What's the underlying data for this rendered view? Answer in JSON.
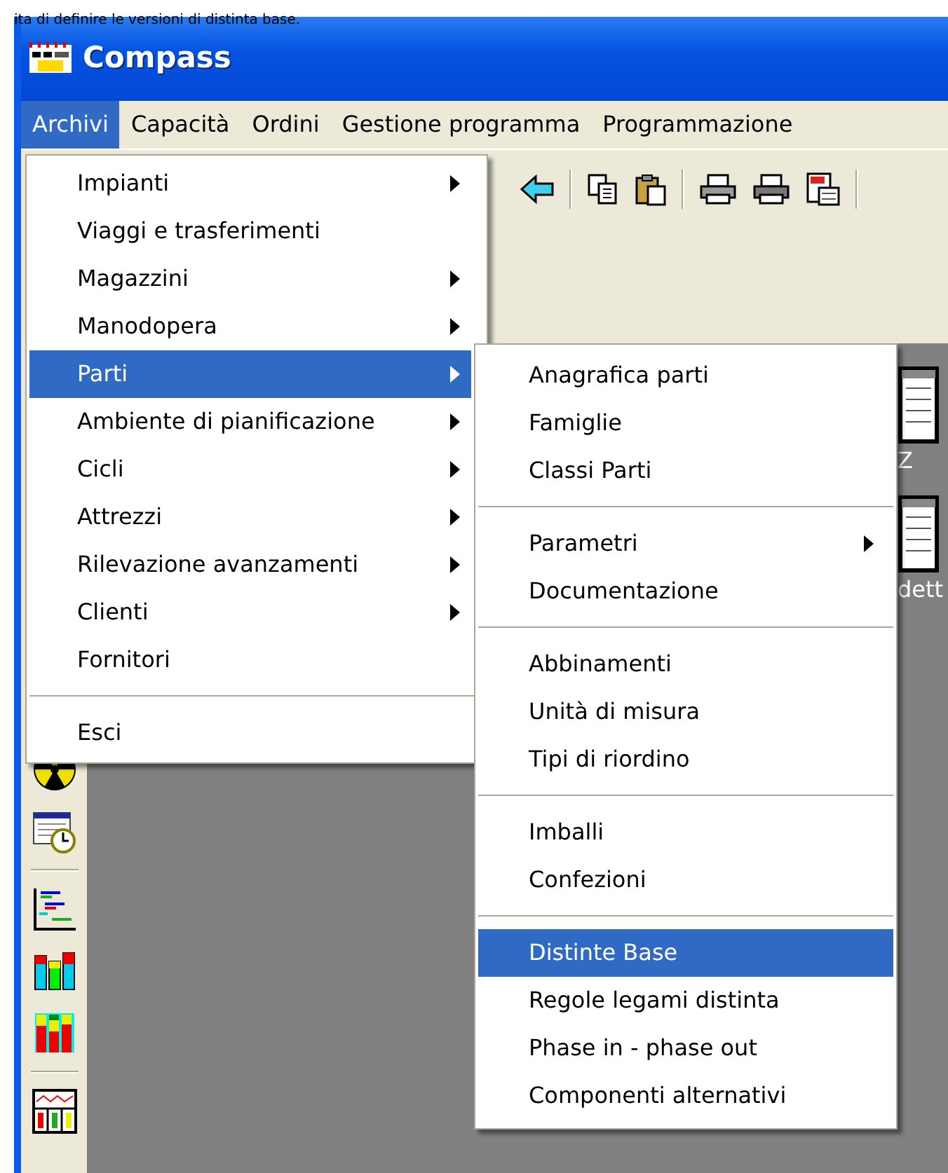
{
  "caption_text": "ita di definire le versioni di distinta base.",
  "window": {
    "title": "Compass"
  },
  "menubar": [
    {
      "label": "Archivi",
      "selected": true
    },
    {
      "label": "Capacità",
      "selected": false
    },
    {
      "label": "Ordini",
      "selected": false
    },
    {
      "label": "Gestione programma",
      "selected": false
    },
    {
      "label": "Programmazione",
      "selected": false
    }
  ],
  "menu": {
    "items": [
      {
        "kind": "item",
        "label": "Impianti",
        "submenu": true,
        "selected": false
      },
      {
        "kind": "item",
        "label": "Viaggi e trasferimenti",
        "submenu": false,
        "selected": false
      },
      {
        "kind": "item",
        "label": "Magazzini",
        "submenu": true,
        "selected": false
      },
      {
        "kind": "item",
        "label": "Manodopera",
        "submenu": true,
        "selected": false
      },
      {
        "kind": "item",
        "label": "Parti",
        "submenu": true,
        "selected": true
      },
      {
        "kind": "item",
        "label": "Ambiente di pianificazione",
        "submenu": true,
        "selected": false
      },
      {
        "kind": "item",
        "label": "Cicli",
        "submenu": true,
        "selected": false
      },
      {
        "kind": "item",
        "label": "Attrezzi",
        "submenu": true,
        "selected": false
      },
      {
        "kind": "item",
        "label": "Rilevazione avanzamenti",
        "submenu": true,
        "selected": false
      },
      {
        "kind": "item",
        "label": "Clienti",
        "submenu": true,
        "selected": false
      },
      {
        "kind": "item",
        "label": "Fornitori",
        "submenu": false,
        "selected": false
      },
      {
        "kind": "separator"
      },
      {
        "kind": "item",
        "label": "Esci",
        "submenu": false,
        "selected": false
      }
    ]
  },
  "submenu": {
    "items": [
      {
        "kind": "item",
        "label": "Anagrafica parti",
        "submenu": false,
        "selected": false
      },
      {
        "kind": "item",
        "label": "Famiglie",
        "submenu": false,
        "selected": false
      },
      {
        "kind": "item",
        "label": "Classi Parti",
        "submenu": false,
        "selected": false
      },
      {
        "kind": "separator"
      },
      {
        "kind": "item",
        "label": "Parametri",
        "submenu": true,
        "selected": false
      },
      {
        "kind": "item",
        "label": "Documentazione",
        "submenu": false,
        "selected": false
      },
      {
        "kind": "separator"
      },
      {
        "kind": "item",
        "label": "Abbinamenti",
        "submenu": false,
        "selected": false
      },
      {
        "kind": "item",
        "label": "Unità di misura",
        "submenu": false,
        "selected": false
      },
      {
        "kind": "item",
        "label": "Tipi di riordino",
        "submenu": false,
        "selected": false
      },
      {
        "kind": "separator"
      },
      {
        "kind": "item",
        "label": "Imballi",
        "submenu": false,
        "selected": false
      },
      {
        "kind": "item",
        "label": "Confezioni",
        "submenu": false,
        "selected": false
      },
      {
        "kind": "separator"
      },
      {
        "kind": "item",
        "label": "Distinte Base",
        "submenu": false,
        "selected": true
      },
      {
        "kind": "item",
        "label": "Regole legami distinta",
        "submenu": false,
        "selected": false
      },
      {
        "kind": "item",
        "label": "Phase in - phase out",
        "submenu": false,
        "selected": false
      },
      {
        "kind": "item",
        "label": "Componenti alternativi",
        "submenu": false,
        "selected": false
      }
    ]
  },
  "desktop_icons": [
    {
      "label": "Z"
    },
    {
      "label": "dett"
    }
  ]
}
